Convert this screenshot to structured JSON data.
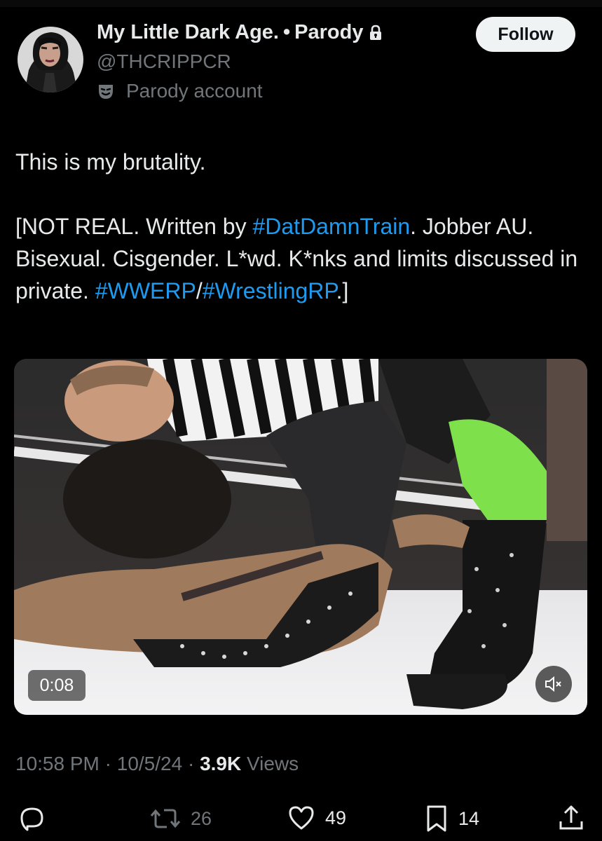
{
  "header": {
    "display_name": "My Little Dark Age.",
    "separator": "•",
    "parody_tag": "Parody",
    "handle": "@THCRIPPCR",
    "parody_label": "Parody account",
    "follow_label": "Follow"
  },
  "tweet": {
    "line1": "This is my brutality.",
    "p2_part1": "[NOT REAL. Written by ",
    "p2_hashtag1": "#DatDamnTrain",
    "p2_part2": ". Jobber AU. Bisexual. Cisgender. L*wd. K*nks and limits discussed in private. ",
    "p2_hashtag2": "#WWERP",
    "p2_slash": "/",
    "p2_hashtag3": "#WrestlingRP",
    "p2_part3": ".]"
  },
  "media": {
    "duration": "0:08",
    "mute_icon": "speaker-muted-icon"
  },
  "meta": {
    "time": "10:58 PM",
    "dot1": "·",
    "date": "10/5/24",
    "dot2": "·",
    "views_count": "3.9K",
    "views_label": "Views"
  },
  "actions": {
    "replies_icon": "reply-icon",
    "reposts_count": "26",
    "likes_count": "49",
    "bookmarks_count": "14",
    "share_icon": "share-icon"
  },
  "colors": {
    "background": "#000000",
    "text_primary": "#e7e9ea",
    "text_secondary": "#71767b",
    "link": "#1d9bf0",
    "follow_bg": "#eff3f4"
  }
}
